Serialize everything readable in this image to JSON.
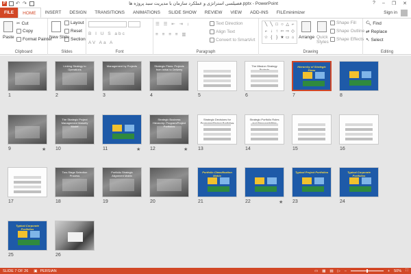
{
  "titlebar": {
    "title": "فصیلسی استراتژی و عملکرد سازمان با مدیریت سبد پروژه ها.pptx - PowerPoint",
    "help": "?",
    "minimize": "–",
    "restore": "❐",
    "close": "✕"
  },
  "tabs": [
    {
      "label": "FILE"
    },
    {
      "label": "HOME"
    },
    {
      "label": "INSERT"
    },
    {
      "label": "DESIGN"
    },
    {
      "label": "TRANSITIONS"
    },
    {
      "label": "ANIMATIONS"
    },
    {
      "label": "SLIDE SHOW"
    },
    {
      "label": "REVIEW"
    },
    {
      "label": "VIEW"
    },
    {
      "label": "ADD-INS"
    },
    {
      "label": "FILEminimizer"
    }
  ],
  "signin": "Sign in",
  "ribbon": {
    "clipboard": {
      "label": "Clipboard",
      "paste": "Paste",
      "cut": "Cut",
      "copy": "Copy",
      "format_painter": "Format Painter"
    },
    "slides": {
      "label": "Slides",
      "new_slide": "New Slide",
      "layout": "Layout",
      "reset": "Reset",
      "section": "Section"
    },
    "font": {
      "label": "Font"
    },
    "paragraph": {
      "label": "Paragraph",
      "text_direction": "Text Direction",
      "align_text": "Align Text",
      "convert_smartart": "Convert to SmartArt"
    },
    "drawing": {
      "label": "Drawing",
      "arrange": "Arrange",
      "quick_styles": "Quick Styles",
      "shape_fill": "Shape Fill",
      "shape_outline": "Shape Outline",
      "shape_effects": "Shape Effects"
    },
    "editing": {
      "label": "Editing",
      "find": "Find",
      "replace": "Replace",
      "select": "Select"
    }
  },
  "slides": [
    {
      "num": "1",
      "kind": "grey",
      "title": ""
    },
    {
      "num": "2",
      "kind": "grey",
      "title": "Linking Strategy to Operations"
    },
    {
      "num": "3",
      "kind": "grey",
      "title": "Management by Projects"
    },
    {
      "num": "4",
      "kind": "grey",
      "title": "Strategic Plans: Projects from Initial to Delivery"
    },
    {
      "num": "5",
      "kind": "white",
      "title": ""
    },
    {
      "num": "6",
      "kind": "white",
      "title": "The Mission Strategy Projects"
    },
    {
      "num": "7",
      "kind": "blue",
      "title": "Hierarchy of Strategic Plans",
      "selected": true
    },
    {
      "num": "8",
      "kind": "blue",
      "title": ""
    },
    {
      "num": "9",
      "kind": "grey",
      "title": "",
      "star": true
    },
    {
      "num": "10",
      "kind": "grey",
      "title": "The Strategic Project Management Maturity Model"
    },
    {
      "num": "11",
      "kind": "blue",
      "title": "",
      "star": true
    },
    {
      "num": "12",
      "kind": "grey",
      "title": "Strategic Business Hierarchy: Program/Project Portfolios",
      "star": true
    },
    {
      "num": "13",
      "kind": "white",
      "title": "Strategic Decisions for Programs/Project Portfolios"
    },
    {
      "num": "14",
      "kind": "white",
      "title": "Strategic Portfolio Roles and Responsibilities"
    },
    {
      "num": "15",
      "kind": "white",
      "title": ""
    },
    {
      "num": "16",
      "kind": "white",
      "title": ""
    },
    {
      "num": "17",
      "kind": "white",
      "title": ""
    },
    {
      "num": "18",
      "kind": "grey",
      "title": "Two-Stage Selection Process"
    },
    {
      "num": "19",
      "kind": "grey",
      "title": "Portfolio Strategic Alignment Matrix"
    },
    {
      "num": "20",
      "kind": "grey",
      "title": ""
    },
    {
      "num": "21",
      "kind": "blue",
      "title": "Portfolio Classification Matrix"
    },
    {
      "num": "22",
      "kind": "blue",
      "title": "",
      "star": true
    },
    {
      "num": "23",
      "kind": "blue",
      "title": "Typical Project Portfolios"
    },
    {
      "num": "24",
      "kind": "blue",
      "title": "Typical Corporate Portfolios"
    },
    {
      "num": "25",
      "kind": "blue",
      "title": "Typical Corporate Portfolios"
    },
    {
      "num": "26",
      "kind": "photo",
      "title": ""
    }
  ],
  "statusbar": {
    "slide_info": "SLIDE 7 OF 26",
    "language": "PERSIAN",
    "zoom": "50%",
    "zoom_fraction": 0.5
  },
  "colors": {
    "accent": "#d24726",
    "slide_blue": "#1e5aa8",
    "canvas_bg": "#e6e6e6"
  }
}
